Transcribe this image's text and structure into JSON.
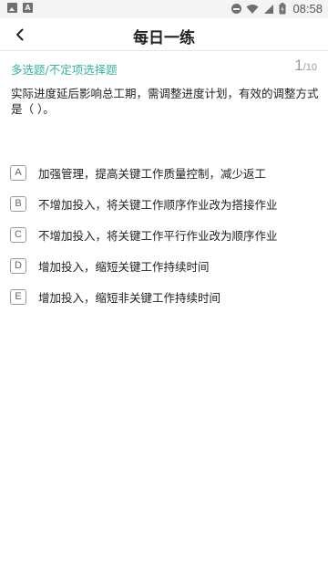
{
  "status_bar": {
    "time": "08:58",
    "left_icons": [
      "image-icon",
      "text-a-icon"
    ],
    "right_icons": [
      "do-not-disturb-icon",
      "wifi-icon",
      "cell-signal-icon",
      "battery-icon"
    ]
  },
  "header": {
    "title": "每日一练",
    "back_icon": "chevron-left-icon"
  },
  "question": {
    "type_label": "多选题/不定项选择题",
    "current": "1",
    "total": "/10",
    "stem": "实际进度延后影响总工期，需调整进度计划，有效的调整方式是（ ）。",
    "options": [
      {
        "letter": "A",
        "text": "加强管理，提高关键工作质量控制，减少返工"
      },
      {
        "letter": "B",
        "text": "不增加投入，将关键工作顺序作业改为搭接作业"
      },
      {
        "letter": "C",
        "text": "不增加投入，将关键工作平行作业改为顺序作业"
      },
      {
        "letter": "D",
        "text": "增加投入，缩短关键工作持续时间"
      },
      {
        "letter": "E",
        "text": "增加投入，缩短非关键工作持续时间"
      }
    ]
  },
  "colors": {
    "accent": "#3db39e",
    "status_bar_bg": "#f4f4f4",
    "text": "#222222",
    "muted": "#9a9a9a"
  }
}
